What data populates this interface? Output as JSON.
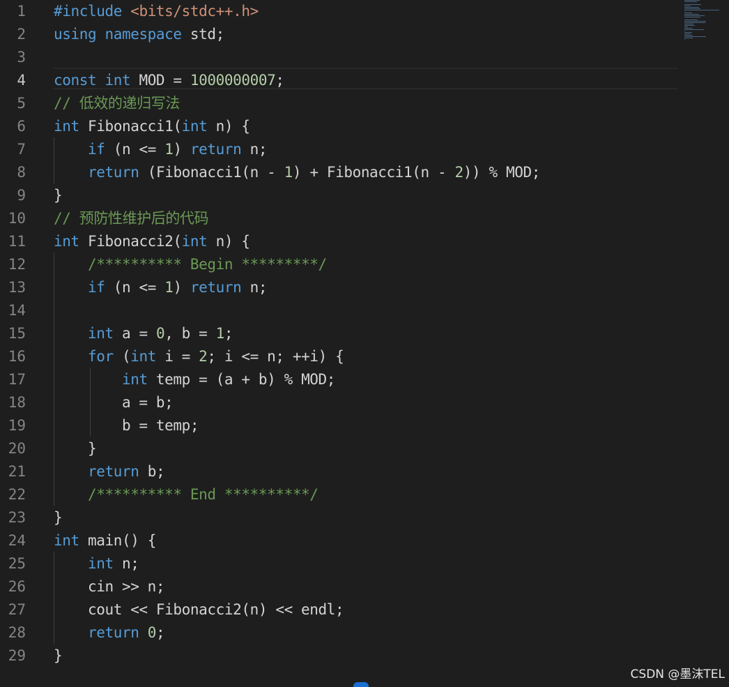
{
  "editor": {
    "active_line": 4,
    "lines": [
      {
        "n": "1",
        "tokens": [
          [
            "inc",
            "#include"
          ],
          [
            "p",
            " "
          ],
          [
            "str",
            "<bits/stdc++.h>"
          ]
        ]
      },
      {
        "n": "2",
        "tokens": [
          [
            "kw",
            "using"
          ],
          [
            "p",
            " "
          ],
          [
            "kw",
            "namespace"
          ],
          [
            "p",
            " std;"
          ]
        ]
      },
      {
        "n": "3",
        "tokens": []
      },
      {
        "n": "4",
        "tokens": [
          [
            "kw",
            "const"
          ],
          [
            "p",
            " "
          ],
          [
            "kw",
            "int"
          ],
          [
            "p",
            " MOD = "
          ],
          [
            "num",
            "1000000007"
          ],
          [
            "p",
            ";"
          ]
        ]
      },
      {
        "n": "5",
        "tokens": [
          [
            "cm",
            "// 低效的递归写法"
          ]
        ]
      },
      {
        "n": "6",
        "tokens": [
          [
            "kw",
            "int"
          ],
          [
            "p",
            " "
          ],
          [
            "fn",
            "Fibonacci1"
          ],
          [
            "p",
            "("
          ],
          [
            "kw",
            "int"
          ],
          [
            "p",
            " n) {"
          ]
        ]
      },
      {
        "n": "7",
        "tokens": [
          [
            "p",
            "    "
          ],
          [
            "ctl",
            "if"
          ],
          [
            "p",
            " (n <= "
          ],
          [
            "num",
            "1"
          ],
          [
            "p",
            ") "
          ],
          [
            "ctl",
            "return"
          ],
          [
            "p",
            " n;"
          ]
        ]
      },
      {
        "n": "8",
        "tokens": [
          [
            "p",
            "    "
          ],
          [
            "ctl",
            "return"
          ],
          [
            "p",
            " ("
          ],
          [
            "fn",
            "Fibonacci1"
          ],
          [
            "p",
            "(n - "
          ],
          [
            "num",
            "1"
          ],
          [
            "p",
            ") + "
          ],
          [
            "fn",
            "Fibonacci1"
          ],
          [
            "p",
            "(n - "
          ],
          [
            "num",
            "2"
          ],
          [
            "p",
            ")) % MOD;"
          ]
        ]
      },
      {
        "n": "9",
        "tokens": [
          [
            "p",
            "}"
          ]
        ]
      },
      {
        "n": "10",
        "tokens": [
          [
            "cm",
            "// 预防性维护后的代码"
          ]
        ]
      },
      {
        "n": "11",
        "tokens": [
          [
            "kw",
            "int"
          ],
          [
            "p",
            " "
          ],
          [
            "fn",
            "Fibonacci2"
          ],
          [
            "p",
            "("
          ],
          [
            "kw",
            "int"
          ],
          [
            "p",
            " n) {"
          ]
        ]
      },
      {
        "n": "12",
        "tokens": [
          [
            "p",
            "    "
          ],
          [
            "cm",
            "/********** Begin *********/"
          ]
        ]
      },
      {
        "n": "13",
        "tokens": [
          [
            "p",
            "    "
          ],
          [
            "ctl",
            "if"
          ],
          [
            "p",
            " (n <= "
          ],
          [
            "num",
            "1"
          ],
          [
            "p",
            ") "
          ],
          [
            "ctl",
            "return"
          ],
          [
            "p",
            " n;"
          ]
        ]
      },
      {
        "n": "14",
        "tokens": []
      },
      {
        "n": "15",
        "tokens": [
          [
            "p",
            "    "
          ],
          [
            "kw",
            "int"
          ],
          [
            "p",
            " a = "
          ],
          [
            "num",
            "0"
          ],
          [
            "p",
            ", b = "
          ],
          [
            "num",
            "1"
          ],
          [
            "p",
            ";"
          ]
        ]
      },
      {
        "n": "16",
        "tokens": [
          [
            "p",
            "    "
          ],
          [
            "ctl",
            "for"
          ],
          [
            "p",
            " ("
          ],
          [
            "kw",
            "int"
          ],
          [
            "p",
            " i = "
          ],
          [
            "num",
            "2"
          ],
          [
            "p",
            "; i <= n; ++i) {"
          ]
        ]
      },
      {
        "n": "17",
        "tokens": [
          [
            "p",
            "        "
          ],
          [
            "kw",
            "int"
          ],
          [
            "p",
            " temp = (a + b) % MOD;"
          ]
        ]
      },
      {
        "n": "18",
        "tokens": [
          [
            "p",
            "        a = b;"
          ]
        ]
      },
      {
        "n": "19",
        "tokens": [
          [
            "p",
            "        b = temp;"
          ]
        ]
      },
      {
        "n": "20",
        "tokens": [
          [
            "p",
            "    }"
          ]
        ]
      },
      {
        "n": "21",
        "tokens": [
          [
            "p",
            "    "
          ],
          [
            "ctl",
            "return"
          ],
          [
            "p",
            " b;"
          ]
        ]
      },
      {
        "n": "22",
        "tokens": [
          [
            "p",
            "    "
          ],
          [
            "cm",
            "/********** End **********/"
          ]
        ]
      },
      {
        "n": "23",
        "tokens": [
          [
            "p",
            "}"
          ]
        ]
      },
      {
        "n": "24",
        "tokens": [
          [
            "kw",
            "int"
          ],
          [
            "p",
            " "
          ],
          [
            "fn",
            "main"
          ],
          [
            "p",
            "() {"
          ]
        ]
      },
      {
        "n": "25",
        "tokens": [
          [
            "p",
            "    "
          ],
          [
            "kw",
            "int"
          ],
          [
            "p",
            " n;"
          ]
        ]
      },
      {
        "n": "26",
        "tokens": [
          [
            "p",
            "    cin >> n;"
          ]
        ]
      },
      {
        "n": "27",
        "tokens": [
          [
            "p",
            "    cout << "
          ],
          [
            "fn",
            "Fibonacci2"
          ],
          [
            "p",
            "(n) << endl;"
          ]
        ]
      },
      {
        "n": "28",
        "tokens": [
          [
            "p",
            "    "
          ],
          [
            "ctl",
            "return"
          ],
          [
            "p",
            " "
          ],
          [
            "num",
            "0"
          ],
          [
            "p",
            ";"
          ]
        ]
      },
      {
        "n": "29",
        "tokens": [
          [
            "p",
            "}"
          ]
        ]
      }
    ]
  },
  "watermark": "CSDN @墨沫TEL"
}
